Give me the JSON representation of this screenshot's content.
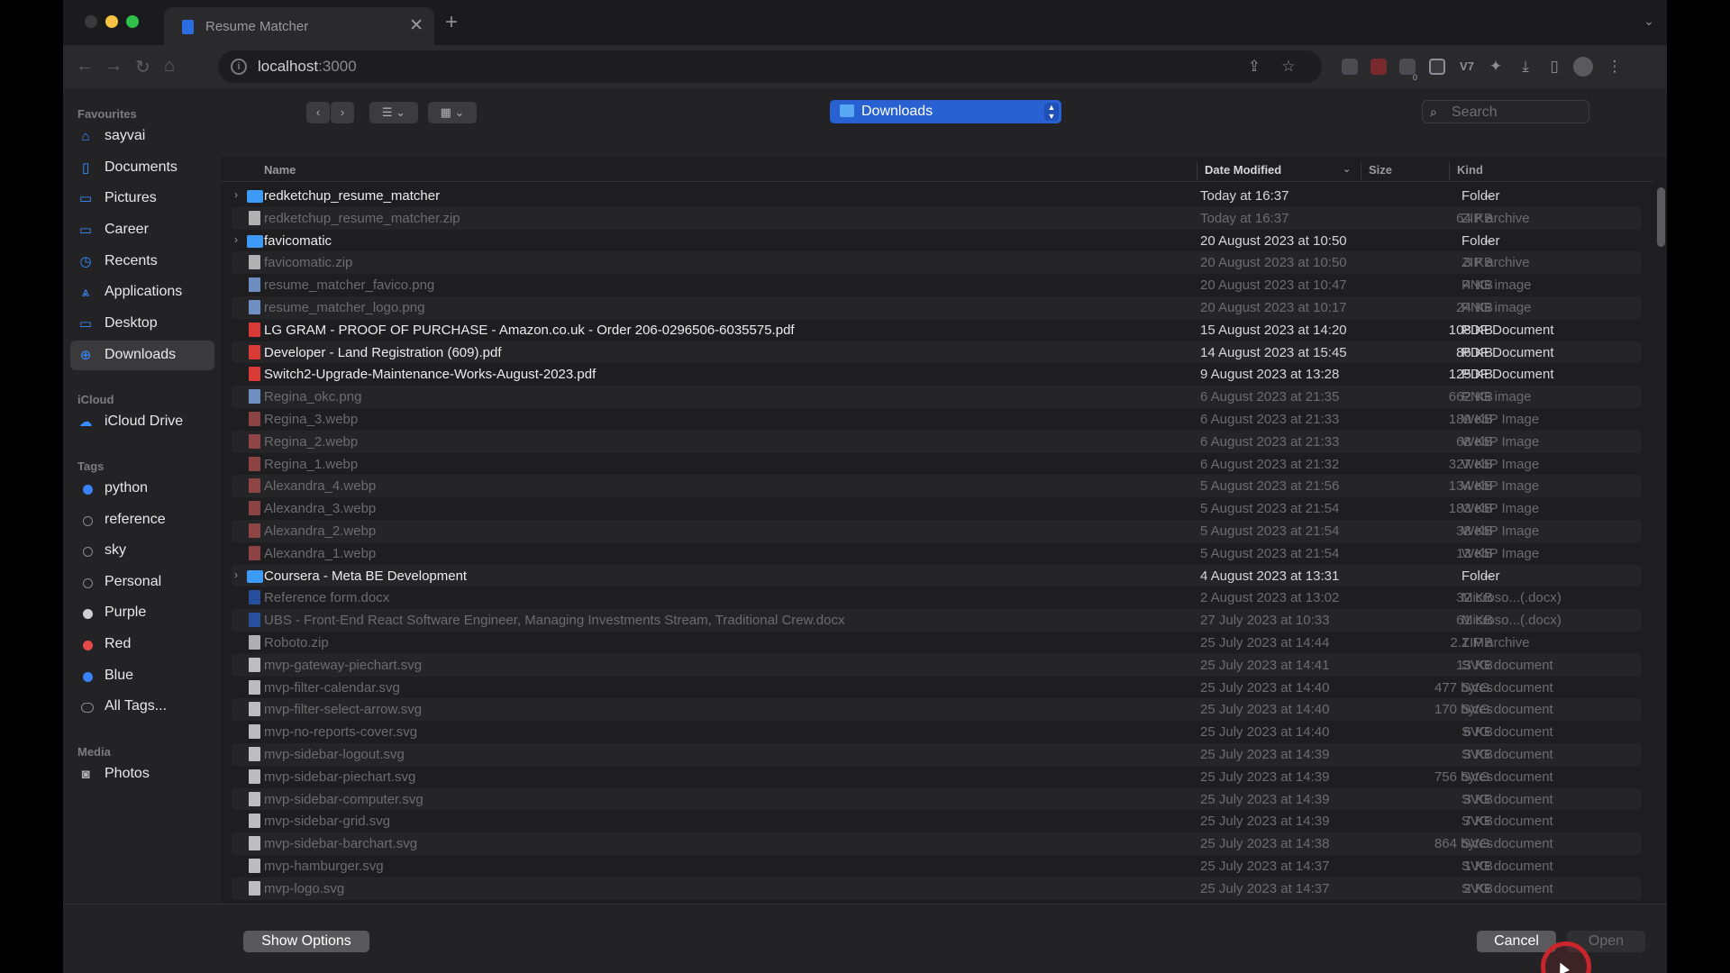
{
  "browser": {
    "tab_title": "Resume Matcher",
    "tab_close": "✕",
    "new_tab": "+",
    "tab_menu": "⌄",
    "url_host": "localhost",
    "url_port": ":3000",
    "nav": {
      "back": "←",
      "forward": "→",
      "reload": "↻",
      "home": "⌂"
    },
    "toolbar_icons": [
      "share-icon",
      "star-icon",
      "extension-icon-1",
      "extension-icon-2",
      "extension-icon-3",
      "extension-icon-4",
      "extension-icon-5",
      "puzzle-icon",
      "download-icon",
      "sidepanel-icon",
      "profile-avatar",
      "menu-icon"
    ],
    "badge": "0"
  },
  "sidebar": {
    "favourites_title": "Favourites",
    "favourites": [
      {
        "label": "sayvai",
        "icon": "home-icon"
      },
      {
        "label": "Documents",
        "icon": "document-icon"
      },
      {
        "label": "Pictures",
        "icon": "pictures-icon"
      },
      {
        "label": "Career",
        "icon": "folder-icon"
      },
      {
        "label": "Recents",
        "icon": "clock-icon"
      },
      {
        "label": "Applications",
        "icon": "applications-icon"
      },
      {
        "label": "Desktop",
        "icon": "desktop-icon"
      },
      {
        "label": "Downloads",
        "icon": "downloads-icon"
      }
    ],
    "icloud_title": "iCloud",
    "icloud": [
      {
        "label": "iCloud Drive",
        "icon": "cloud-icon"
      }
    ],
    "tags_title": "Tags",
    "tags": [
      {
        "label": "python",
        "color": "#3a82f7"
      },
      {
        "label": "reference",
        "color": ""
      },
      {
        "label": "sky",
        "color": ""
      },
      {
        "label": "Personal",
        "color": ""
      },
      {
        "label": "Purple",
        "color": "#cfcfd4"
      },
      {
        "label": "Red",
        "color": "#e84a4a"
      },
      {
        "label": "Blue",
        "color": "#3a82f7"
      },
      {
        "label": "All Tags...",
        "color": "all"
      }
    ],
    "media_title": "Media",
    "media": [
      {
        "label": "Photos",
        "icon": "camera-icon"
      }
    ]
  },
  "toolbar": {
    "location": "Downloads",
    "search_placeholder": "Search"
  },
  "columns": {
    "name": "Name",
    "date": "Date Modified",
    "size": "Size",
    "kind": "Kind"
  },
  "files": [
    {
      "name": "redketchup_resume_matcher",
      "date": "Today at 16:37",
      "size": "--",
      "kind": "Folder",
      "type": "folder",
      "enabled": true
    },
    {
      "name": "redketchup_resume_matcher.zip",
      "date": "Today at 16:37",
      "size": "64 KB",
      "kind": "ZIP archive",
      "type": "zip",
      "enabled": false
    },
    {
      "name": "favicomatic",
      "date": "20 August 2023 at 10:50",
      "size": "--",
      "kind": "Folder",
      "type": "folder",
      "enabled": true
    },
    {
      "name": "favicomatic.zip",
      "date": "20 August 2023 at 10:50",
      "size": "3 KB",
      "kind": "ZIP archive",
      "type": "zip",
      "enabled": false
    },
    {
      "name": "resume_matcher_favico.png",
      "date": "20 August 2023 at 10:47",
      "size": "4 KB",
      "kind": "PNG image",
      "type": "png",
      "enabled": false
    },
    {
      "name": "resume_matcher_logo.png",
      "date": "20 August 2023 at 10:17",
      "size": "24 KB",
      "kind": "PNG image",
      "type": "png",
      "enabled": false
    },
    {
      "name": "LG GRAM - PROOF OF PURCHASE - Amazon.co.uk - Order 206-0296506-6035575.pdf",
      "date": "15 August 2023 at 14:20",
      "size": "108 KB",
      "kind": "PDF Document",
      "type": "pdf",
      "enabled": true
    },
    {
      "name": "Developer - Land Registration (609).pdf",
      "date": "14 August 2023 at 15:45",
      "size": "86 KB",
      "kind": "PDF Document",
      "type": "pdf",
      "enabled": true
    },
    {
      "name": "Switch2-Upgrade-Maintenance-Works-August-2023.pdf",
      "date": "9 August 2023 at 13:28",
      "size": "125 KB",
      "kind": "PDF Document",
      "type": "pdf",
      "enabled": true
    },
    {
      "name": "Regina_okc.png",
      "date": "6 August 2023 at 21:35",
      "size": "662 KB",
      "kind": "PNG image",
      "type": "png",
      "enabled": false
    },
    {
      "name": "Regina_3.webp",
      "date": "6 August 2023 at 21:33",
      "size": "189 KB",
      "kind": "WebP Image",
      "type": "webp",
      "enabled": false
    },
    {
      "name": "Regina_2.webp",
      "date": "6 August 2023 at 21:33",
      "size": "68 KB",
      "kind": "WebP Image",
      "type": "webp",
      "enabled": false
    },
    {
      "name": "Regina_1.webp",
      "date": "6 August 2023 at 21:32",
      "size": "327 KB",
      "kind": "WebP Image",
      "type": "webp",
      "enabled": false
    },
    {
      "name": "Alexandra_4.webp",
      "date": "5 August 2023 at 21:56",
      "size": "134 KB",
      "kind": "WebP Image",
      "type": "webp",
      "enabled": false
    },
    {
      "name": "Alexandra_3.webp",
      "date": "5 August 2023 at 21:54",
      "size": "183 KB",
      "kind": "WebP Image",
      "type": "webp",
      "enabled": false
    },
    {
      "name": "Alexandra_2.webp",
      "date": "5 August 2023 at 21:54",
      "size": "38 KB",
      "kind": "WebP Image",
      "type": "webp",
      "enabled": false
    },
    {
      "name": "Alexandra_1.webp",
      "date": "5 August 2023 at 21:54",
      "size": "13 KB",
      "kind": "WebP Image",
      "type": "webp",
      "enabled": false
    },
    {
      "name": "Coursera - Meta BE Development",
      "date": "4 August 2023 at 13:31",
      "size": "--",
      "kind": "Folder",
      "type": "folder",
      "enabled": true
    },
    {
      "name": "Reference form.docx",
      "date": "2 August 2023 at 13:02",
      "size": "32 KB",
      "kind": "Microso...(.docx)",
      "type": "docx",
      "enabled": false
    },
    {
      "name": "UBS - Front-End React Software Engineer, Managing Investments Stream, Traditional Crew.docx",
      "date": "27 July 2023 at 10:33",
      "size": "61 KB",
      "kind": "Microso...(.docx)",
      "type": "docx",
      "enabled": false
    },
    {
      "name": "Roboto.zip",
      "date": "25 July 2023 at 14:44",
      "size": "2.1 MB",
      "kind": "ZIP archive",
      "type": "zip",
      "enabled": false
    },
    {
      "name": "mvp-gateway-piechart.svg",
      "date": "25 July 2023 at 14:41",
      "size": "13 KB",
      "kind": "SVG document",
      "type": "svg",
      "enabled": false
    },
    {
      "name": "mvp-filter-calendar.svg",
      "date": "25 July 2023 at 14:40",
      "size": "477 bytes",
      "kind": "SVG document",
      "type": "svg",
      "enabled": false
    },
    {
      "name": "mvp-filter-select-arrow.svg",
      "date": "25 July 2023 at 14:40",
      "size": "170 bytes",
      "kind": "SVG document",
      "type": "svg",
      "enabled": false
    },
    {
      "name": "mvp-no-reports-cover.svg",
      "date": "25 July 2023 at 14:40",
      "size": "6 KB",
      "kind": "SVG document",
      "type": "svg",
      "enabled": false
    },
    {
      "name": "mvp-sidebar-logout.svg",
      "date": "25 July 2023 at 14:39",
      "size": "3 KB",
      "kind": "SVG document",
      "type": "svg",
      "enabled": false
    },
    {
      "name": "mvp-sidebar-piechart.svg",
      "date": "25 July 2023 at 14:39",
      "size": "756 bytes",
      "kind": "SVG document",
      "type": "svg",
      "enabled": false
    },
    {
      "name": "mvp-sidebar-computer.svg",
      "date": "25 July 2023 at 14:39",
      "size": "3 KB",
      "kind": "SVG document",
      "type": "svg",
      "enabled": false
    },
    {
      "name": "mvp-sidebar-grid.svg",
      "date": "25 July 2023 at 14:39",
      "size": "7 KB",
      "kind": "SVG document",
      "type": "svg",
      "enabled": false
    },
    {
      "name": "mvp-sidebar-barchart.svg",
      "date": "25 July 2023 at 14:38",
      "size": "864 bytes",
      "kind": "SVG document",
      "type": "svg",
      "enabled": false
    },
    {
      "name": "mvp-hamburger.svg",
      "date": "25 July 2023 at 14:37",
      "size": "1 KB",
      "kind": "SVG document",
      "type": "svg",
      "enabled": false
    },
    {
      "name": "mvp-logo.svg",
      "date": "25 July 2023 at 14:37",
      "size": "2 KB",
      "kind": "SVG document",
      "type": "svg",
      "enabled": false
    }
  ],
  "footer": {
    "show_options": "Show Options",
    "cancel": "Cancel",
    "open": "Open"
  },
  "colors": {
    "accent": "#2861d2",
    "folder": "#3d9bf5",
    "pdf": "#d93a35",
    "docx": "#2b5fc7",
    "cursor_ring": "#c8262c"
  }
}
